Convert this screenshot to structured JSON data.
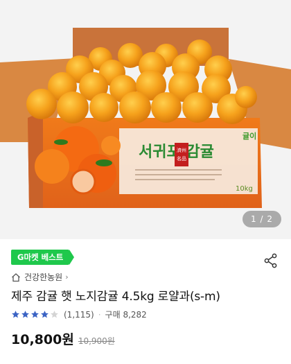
{
  "gallery": {
    "box_title": "서귀포 감귤",
    "box_logo": "귤이",
    "box_weight": "10kg",
    "box_stamp": "濟州名品",
    "page_indicator": "1 / 2"
  },
  "badge": {
    "label": "G마켓 베스트"
  },
  "store": {
    "name": "건강한농원",
    "chevron": "›"
  },
  "product": {
    "title": "제주 감귤 햇 노지감귤 4.5kg 로얄과(s-m)",
    "rating_stars": 4,
    "rating_max": 5,
    "review_count": "(1,115)",
    "separator": "·",
    "purchase_label": "구매 8,282",
    "price": "10,800원",
    "original_price": "10,900원"
  },
  "colors": {
    "badge_green": "#1fc84c",
    "star_blue": "#3b63c4",
    "orange": "#f39a1e"
  },
  "icons": [
    "share-icon",
    "home-icon",
    "star-icon"
  ]
}
